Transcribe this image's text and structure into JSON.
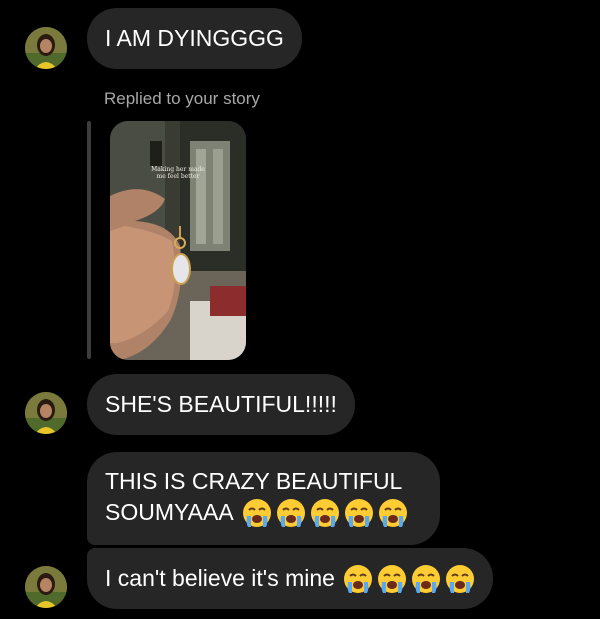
{
  "messages": [
    {
      "text": "I AM DYINGGGG"
    },
    {
      "text": "SHE'S BEAUTIFUL!!!!!"
    },
    {
      "line1": "THIS IS CRAZY BEAUTIFUL",
      "line2": "SOUMYAAA",
      "emoji": [
        "loudly-crying-face",
        "loudly-crying-face",
        "loudly-crying-face",
        "loudly-crying-face",
        "loudly-crying-face"
      ]
    },
    {
      "text": "I can't believe it's mine",
      "emoji": [
        "loudly-crying-face",
        "loudly-crying-face",
        "loudly-crying-face",
        "loudly-crying-face"
      ]
    }
  ],
  "story_reply": {
    "label": "Replied to your story",
    "caption": "Making her made me feel better"
  },
  "colors": {
    "background": "#000000",
    "bubble": "#262626",
    "secondary_text": "#a8a8a8"
  }
}
